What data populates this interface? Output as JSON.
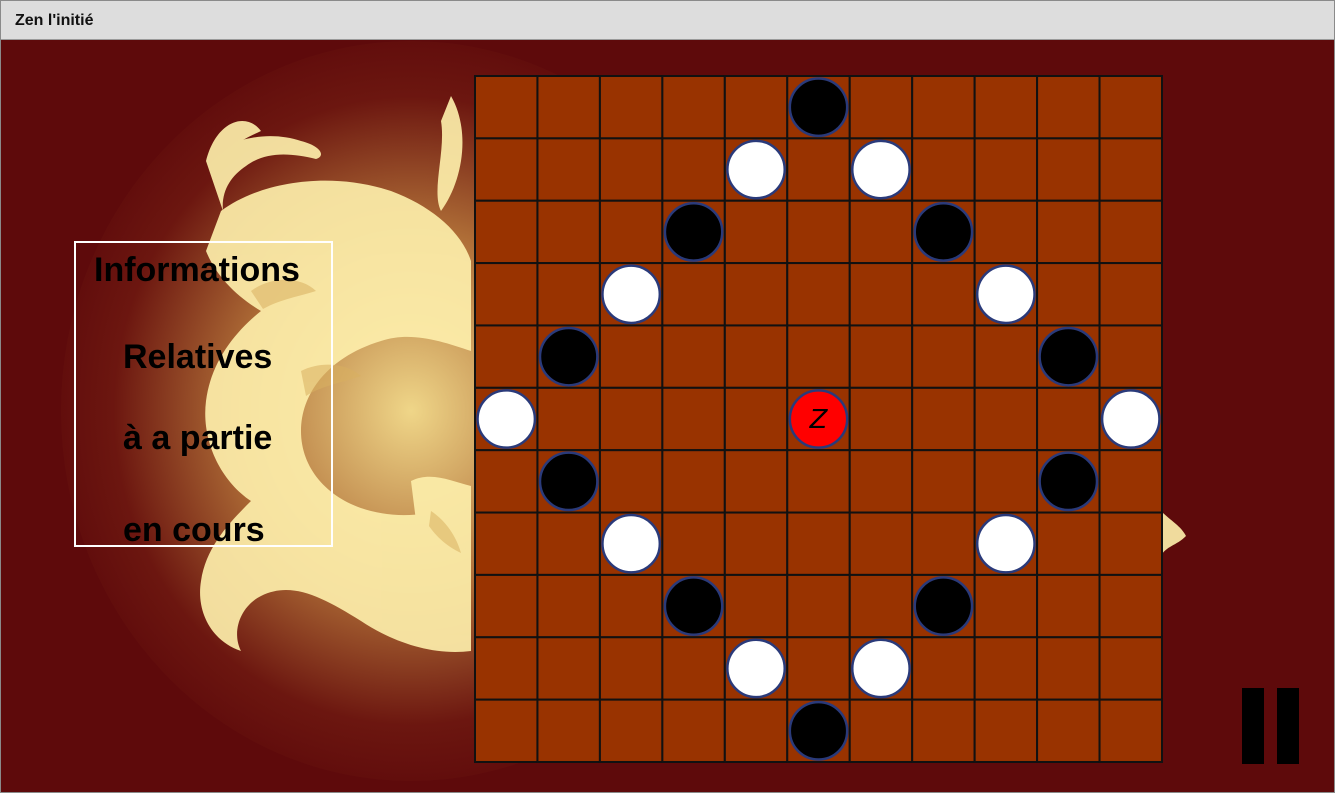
{
  "window": {
    "title": "Zen l'initié"
  },
  "info_panel": {
    "lines": [
      "Informations",
      "Relatives",
      "à a partie",
      "en cours"
    ]
  },
  "board": {
    "rows": 11,
    "cols": 11,
    "colors": {
      "square": "#993300",
      "grid_line": "#111111",
      "black_piece": "#000000",
      "white_piece": "#ffffff",
      "piece_border": "#2a3a7a",
      "zen_piece": "#ff0000"
    },
    "pieces": [
      {
        "row": 0,
        "col": 5,
        "color": "black"
      },
      {
        "row": 1,
        "col": 4,
        "color": "white"
      },
      {
        "row": 1,
        "col": 6,
        "color": "white"
      },
      {
        "row": 2,
        "col": 3,
        "color": "black"
      },
      {
        "row": 2,
        "col": 7,
        "color": "black"
      },
      {
        "row": 3,
        "col": 2,
        "color": "white"
      },
      {
        "row": 3,
        "col": 8,
        "color": "white"
      },
      {
        "row": 4,
        "col": 1,
        "color": "black"
      },
      {
        "row": 4,
        "col": 9,
        "color": "black"
      },
      {
        "row": 5,
        "col": 0,
        "color": "white"
      },
      {
        "row": 5,
        "col": 5,
        "color": "zen",
        "label": "Z"
      },
      {
        "row": 5,
        "col": 10,
        "color": "white"
      },
      {
        "row": 6,
        "col": 1,
        "color": "black"
      },
      {
        "row": 6,
        "col": 9,
        "color": "black"
      },
      {
        "row": 7,
        "col": 2,
        "color": "white"
      },
      {
        "row": 7,
        "col": 8,
        "color": "white"
      },
      {
        "row": 8,
        "col": 3,
        "color": "black"
      },
      {
        "row": 8,
        "col": 7,
        "color": "black"
      },
      {
        "row": 9,
        "col": 4,
        "color": "white"
      },
      {
        "row": 9,
        "col": 6,
        "color": "white"
      },
      {
        "row": 10,
        "col": 5,
        "color": "black"
      }
    ]
  },
  "controls": {
    "pause_icon": "pause-icon"
  }
}
